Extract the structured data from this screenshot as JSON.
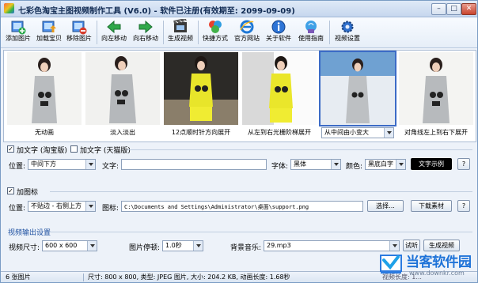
{
  "window": {
    "title": "七彩色淘宝主图视频制作工具 (V6.0) - 软件已注册(有效期至: 2099-09-09)",
    "controls": {
      "minimize": "–",
      "maximize": "□",
      "close": "✕"
    }
  },
  "toolbar": [
    {
      "label": "添加图片",
      "icon": "add-image-icon"
    },
    {
      "label": "加载宝贝",
      "icon": "load-item-icon"
    },
    {
      "label": "移除图片",
      "icon": "remove-image-icon"
    },
    {
      "label": "向左移动",
      "icon": "arrow-left-icon"
    },
    {
      "label": "向右移动",
      "icon": "arrow-right-icon"
    },
    {
      "label": "生成视频",
      "icon": "film-icon"
    },
    {
      "label": "快捷方式",
      "icon": "shortcut-icon"
    },
    {
      "label": "官方网站",
      "icon": "ie-icon"
    },
    {
      "label": "关于软件",
      "icon": "info-icon"
    },
    {
      "label": "使用指南",
      "icon": "guide-icon"
    },
    {
      "label": "视频设置",
      "icon": "gear-icon"
    }
  ],
  "thumbnails": [
    {
      "caption": "无动画"
    },
    {
      "caption": "淡入淡出"
    },
    {
      "caption": "12点顺时针方向展开"
    },
    {
      "caption": "从左到右光栅阶梯展开"
    },
    {
      "caption": "从中间由小变大",
      "dropdown": true
    },
    {
      "caption": "对角线左上到右下展开"
    }
  ],
  "text_overlay": {
    "chk_taobao": "加文字 (淘宝版)",
    "chk_tmall": "加文字 (天猫版)",
    "position_label": "位置:",
    "position_value": "中间下方",
    "text_label": "文字:",
    "text_value": "",
    "font_label": "字体:",
    "font_value": "黑体",
    "color_label": "颜色:",
    "color_value": "黑底白字",
    "sample": "文字示例",
    "help": "?"
  },
  "watermark": {
    "chk_label": "加图标",
    "position_label": "位置:",
    "position_value": "不贴边 - 右侧上方",
    "icon_label": "图标:",
    "icon_path": "C:\\Documents and Settings\\Administrator\\桌面\\support.png",
    "choose": "选择...",
    "download": "下载素材",
    "help": "?"
  },
  "output": {
    "section": "视频输出设置",
    "size_label": "视频尺寸:",
    "size_value": "600 x 600",
    "pause_label": "图片停顿:",
    "pause_value": "1.0秒",
    "music_label": "背景音乐:",
    "music_value": "29.mp3",
    "listen": "试听",
    "generate": "生成视频"
  },
  "status": {
    "count": "6 张图片",
    "info": "尺寸: 800 x 800, 类型: JPEG 图片, 大小: 204.2 KB, 动画长度: 1.68秒",
    "duration": "视频长度: 1..."
  },
  "brand": {
    "name": "当客软件园",
    "url": "www.downkr.com"
  },
  "colors": {
    "accent": "#2c6ad0",
    "sample_bg": "#000000",
    "brand_blue": "#1f73d8"
  }
}
